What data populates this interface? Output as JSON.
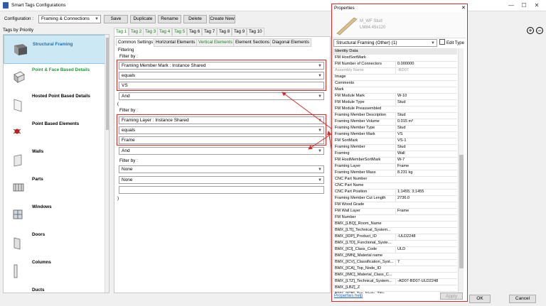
{
  "window": {
    "title": "Smart Tags Configurations"
  },
  "toolbar": {
    "config_label": "Configuration :",
    "config_value": "Framing & Connections",
    "buttons": [
      "Save",
      "Duplicate",
      "Rename",
      "Delete",
      "Create New"
    ]
  },
  "sidebar": {
    "header": "Tags by Priority",
    "items": [
      {
        "label": "Structural Framing",
        "color": "#1f6fb0",
        "icon": "beam-icon"
      },
      {
        "label": "Point & Face Based Details",
        "color": "#1f9a3a",
        "icon": "cube-icon"
      },
      {
        "label": "Hosted Point Based Details",
        "color": "#000000",
        "icon": "panel-icon"
      },
      {
        "label": "Point Based Elements",
        "color": "#000000",
        "icon": "bug-icon"
      },
      {
        "label": "Walls",
        "color": "#000000",
        "icon": "wall-icon"
      },
      {
        "label": "Parts",
        "color": "#000000",
        "icon": "parts-icon"
      },
      {
        "label": "Windows",
        "color": "#000000",
        "icon": "window-icon"
      },
      {
        "label": "Doors",
        "color": "#000000",
        "icon": "door-icon"
      },
      {
        "label": "Columns",
        "color": "#000000",
        "icon": "column-icon"
      },
      {
        "label": "Ducts",
        "color": "#000000",
        "icon": "duct-icon"
      }
    ]
  },
  "tags": [
    "Tag 1",
    "Tag 2",
    "Tag 3",
    "Tag 4",
    "Tag 5",
    "Tag 6",
    "Tag 7",
    "Tag 8",
    "Tag 9",
    "Tag 10"
  ],
  "settings_tabs": [
    "Common Settings",
    "Horizontal Elements",
    "Vertical Elements",
    "Element Sections",
    "Diagonal Elements"
  ],
  "filtering": {
    "title": "Filtering",
    "filter_label": "Filter by :",
    "filter1": {
      "field": "Framing Member Mark : Instance Shared",
      "op": "equals",
      "value": "VS"
    },
    "and1": "And",
    "paren_open": "(",
    "filter2": {
      "field": "Framing Layer : Instance Shared",
      "op": "equals",
      "value": "Frame"
    },
    "and2": "And",
    "filter3": {
      "field": "None",
      "op": "None",
      "value": ""
    },
    "paren_close": ")"
  },
  "properties": {
    "title": "Properties",
    "type_name": "M_WF Stud",
    "type_size": "LM84.45x120",
    "selector": "Structural Framing (Other) (1)",
    "edit_type": "Edit Type",
    "section": "Identity Data",
    "rows": [
      {
        "n": "FM HostSortMark",
        "v": ""
      },
      {
        "n": "FM Number of Connectors",
        "v": "0.000000"
      },
      {
        "n": "Assembly Name",
        "v": "-BD07"
      },
      {
        "n": "Image",
        "v": ""
      },
      {
        "n": "Comments",
        "v": ""
      },
      {
        "n": "Mark",
        "v": ""
      },
      {
        "n": "FM Module Mark",
        "v": "W-10"
      },
      {
        "n": "FM Module Type",
        "v": "Stud"
      },
      {
        "n": "FM Module Preassembled",
        "v": ""
      },
      {
        "n": "Framing Member Description",
        "v": "Stud"
      },
      {
        "n": "Framing Member Volume",
        "v": "0.015 m³"
      },
      {
        "n": "Framing Member Type",
        "v": "Stud"
      },
      {
        "n": "Framing Member Mark",
        "v": "VS"
      },
      {
        "n": "FM SortMark",
        "v": "VS-1"
      },
      {
        "n": "Framing Member",
        "v": "Stud"
      },
      {
        "n": "Framing",
        "v": "Wall"
      },
      {
        "n": "FM HostMemberSortMark",
        "v": "W-7"
      },
      {
        "n": "Framing Layer",
        "v": "Frame"
      },
      {
        "n": "Framing Member Mass",
        "v": "8.231 kg"
      },
      {
        "n": "CNC Part Number",
        "v": ""
      },
      {
        "n": "CNC Part Name",
        "v": ""
      },
      {
        "n": "CNC Part Position",
        "v": "1;1455; 3;1455"
      },
      {
        "n": "Framing Member Cut Length",
        "v": "2736.0"
      },
      {
        "n": "FM Wood Grade",
        "v": ""
      },
      {
        "n": "FM Wall Layer",
        "v": "Frame"
      },
      {
        "n": "FM Number",
        "v": ""
      },
      {
        "n": "BMX_[LBQ]_Room_Name",
        "v": ""
      },
      {
        "n": "BMX_[LTI]_Technical_System...",
        "v": ""
      },
      {
        "n": "BMX_[IDP]_Product_ID",
        "v": "-ULD2248"
      },
      {
        "n": "BMX_[LTD]_Functional_Syste...",
        "v": ""
      },
      {
        "n": "BMX_[ICI]_Class_Code",
        "v": "ULD"
      },
      {
        "n": "BMX_[IMN]_Material name",
        "v": ""
      },
      {
        "n": "BMX_[ICV]_Classification_Syst...",
        "v": "7"
      },
      {
        "n": "BMX_[ICA]_Top_Node_ID",
        "v": ""
      },
      {
        "n": "BMX_[IMC]_Material_Class_C...",
        "v": ""
      },
      {
        "n": "BMX_[LTZ]_Technical_System...",
        "v": "-AD07-BD07-ULD2248"
      },
      {
        "n": "BMX_[LBZ]_Z",
        "v": ""
      },
      {
        "n": "BMX_[ICB]_Top_Node_Title",
        "v": ""
      }
    ],
    "help": "Properties help",
    "apply": "Apply"
  },
  "footer": {
    "ok": "OK",
    "cancel": "Cancel"
  },
  "colors": {
    "accent_red": "#d42a2a",
    "selected_bg": "#cce8f4",
    "green_tab": "#208020"
  }
}
